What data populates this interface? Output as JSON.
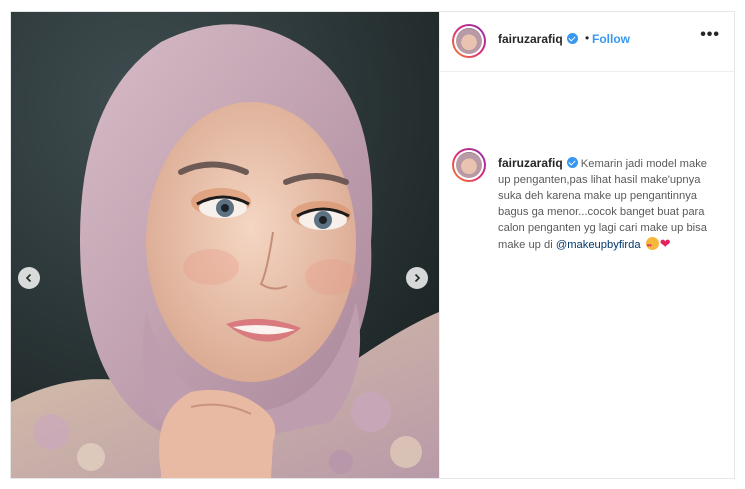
{
  "post": {
    "username": "fairuzarafiq",
    "follow_label": "Follow",
    "separator": "•",
    "more_label": "•••",
    "caption": {
      "username": "fairuzarafiq",
      "text": "Kemarin jadi model make up penganten,pas lihat hasil make'upnya suka deh karena make up pengantinnya bagus ga menor...cocok banget buat para calon penganten yg lagi cari make up bisa make up di",
      "mention": "@makeupbyfirda",
      "emojis": [
        "heart-eyes-emoji",
        "red-heart-emoji"
      ],
      "heart": "❤"
    }
  },
  "icons": {
    "prev": "chevron-left-icon",
    "next": "chevron-right-icon",
    "verified": "verified-badge-icon"
  },
  "colors": {
    "accent": "#3897f0",
    "mention": "#00376b",
    "hijab": "#c9a9b6"
  }
}
